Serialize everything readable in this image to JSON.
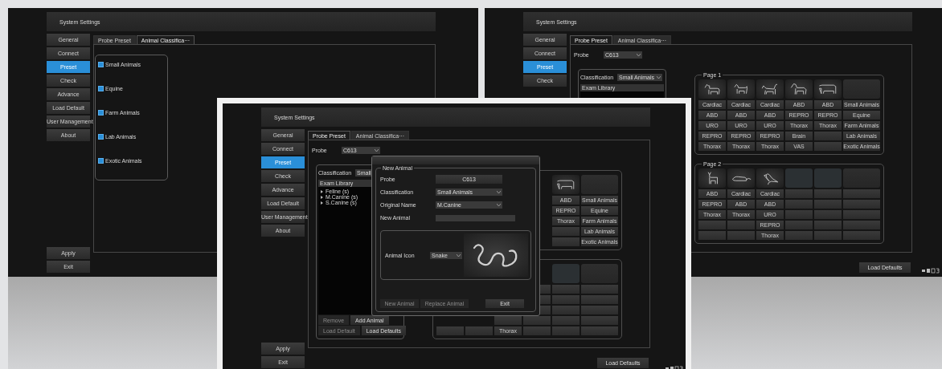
{
  "screens": [
    {
      "kind": "classification",
      "title": "System Settings",
      "sidebar": [
        {
          "label": "General",
          "selected": false
        },
        {
          "label": "Connect",
          "selected": false
        },
        {
          "label": "Preset",
          "selected": true
        },
        {
          "label": "Check",
          "selected": false
        },
        {
          "label": "Advance",
          "selected": false
        },
        {
          "label": "Load Default",
          "selected": false
        },
        {
          "label": "User Management",
          "selected": false
        },
        {
          "label": "About",
          "selected": false
        }
      ],
      "footer_buttons": [
        "Apply",
        "Exit"
      ],
      "tabs": [
        {
          "label": "Probe Preset",
          "selected": false
        },
        {
          "label": "Animal Classifica···",
          "selected": true
        }
      ],
      "animal_classes": [
        {
          "label": "Small Animals",
          "checked": true
        },
        {
          "label": "Equine",
          "checked": true
        },
        {
          "label": "Farm Animals",
          "checked": true
        },
        {
          "label": "Lab Animals",
          "checked": true
        },
        {
          "label": "Exotic Animals",
          "checked": true
        }
      ]
    },
    {
      "kind": "preset",
      "title": "System Settings",
      "sidebar": [
        {
          "label": "General",
          "selected": false
        },
        {
          "label": "Connect",
          "selected": false
        },
        {
          "label": "Preset",
          "selected": true
        },
        {
          "label": "Check",
          "selected": false
        }
      ],
      "tabs": [
        {
          "label": "Probe Preset",
          "selected": true
        },
        {
          "label": "Animal Classifica···",
          "selected": false
        }
      ],
      "probe": {
        "label": "Probe",
        "value": "C613"
      },
      "classification": {
        "label": "Classification",
        "value": "Small Animals",
        "library_header": "Exam Library"
      },
      "pages": [
        {
          "title": "Page 1",
          "columns": [
            {
              "kind": "animal",
              "cells": [
                "Cardiac",
                "ABD",
                "URO",
                "REPRO",
                "Thorax"
              ]
            },
            {
              "kind": "animal",
              "cells": [
                "Cardiac",
                "ABD",
                "URO",
                "REPRO",
                "Thorax"
              ]
            },
            {
              "kind": "animal",
              "cells": [
                "Cardiac",
                "ABD",
                "URO",
                "REPRO",
                "Thorax"
              ]
            },
            {
              "kind": "animal",
              "cells": [
                "ABD",
                "REPRO",
                "Thorax",
                "Brain",
                "VAS"
              ]
            },
            {
              "kind": "animal",
              "cells": [
                "ABD",
                "REPRO",
                "Thorax",
                null,
                null
              ]
            },
            {
              "kind": "blank",
              "cells": [
                "Small Animals",
                "Equine",
                "Farm Animals",
                "Lab Animals",
                "Exotic Animals"
              ]
            }
          ]
        },
        {
          "title": "Page 2",
          "columns": [
            {
              "kind": "animal",
              "cells": [
                "ABD",
                "REPRO",
                "Thorax",
                null,
                null
              ]
            },
            {
              "kind": "animal",
              "cells": [
                "Cardiac",
                "ABD",
                "Thorax",
                null,
                null
              ]
            },
            {
              "kind": "animal",
              "cells": [
                "Cardiac",
                "ABD",
                "URO",
                "REPRO",
                "Thorax"
              ]
            },
            {
              "kind": "empty",
              "cells": [
                null,
                null,
                null,
                null,
                null
              ]
            },
            {
              "kind": "empty",
              "cells": [
                null,
                null,
                null,
                null,
                null
              ]
            },
            {
              "kind": "blank",
              "cells": [
                null,
                null,
                null,
                null,
                null
              ]
            }
          ]
        }
      ],
      "load_defaults": "Load Defaults"
    },
    {
      "kind": "preset",
      "title": "System Settings",
      "sidebar": [
        {
          "label": "General",
          "selected": false
        },
        {
          "label": "Connect",
          "selected": false
        },
        {
          "label": "Preset",
          "selected": true
        },
        {
          "label": "Check",
          "selected": false
        },
        {
          "label": "Advance",
          "selected": false
        },
        {
          "label": "Load Default",
          "selected": false
        },
        {
          "label": "User Management",
          "selected": false
        },
        {
          "label": "About",
          "selected": false
        }
      ],
      "footer_buttons": [
        "Apply",
        "Exit"
      ],
      "tabs": [
        {
          "label": "Probe Preset",
          "selected": true
        },
        {
          "label": "Animal Classifica···",
          "selected": false
        }
      ],
      "probe": {
        "label": "Probe",
        "value": "C613"
      },
      "classification": {
        "label": "Classification",
        "value": "Small",
        "library_header": "Exam Library",
        "library": [
          "Feline (s)",
          "M.Canine (s)",
          "S.Canine (s)"
        ],
        "buttons": [
          [
            {
              "label": "Remove",
              "disabled": true
            },
            {
              "label": "Add Animal",
              "disabled": false
            }
          ],
          [
            {
              "label": "Load Default",
              "disabled": true
            },
            {
              "label": "Load Defaults",
              "disabled": false
            }
          ]
        ]
      },
      "pages": [
        {
          "columns": [
            {
              "kind": "animal",
              "cells": [
                "ABD",
                "REPRO",
                "Thorax",
                null,
                null
              ]
            },
            {
              "kind": "blank",
              "cells": [
                "Small Animals",
                "Equine",
                "Farm Animals",
                "Lab Animals",
                "Exotic Animals"
              ]
            }
          ]
        },
        {
          "columns": [
            {
              "cells": [
                null
              ]
            },
            {
              "cells": [
                null
              ]
            },
            {
              "cells": [
                null,
                null,
                null,
                null,
                "Thorax"
              ]
            },
            {
              "cells": [
                null,
                null,
                null,
                null,
                null
              ]
            },
            {
              "kind": "empty",
              "cells": [
                null,
                null,
                null,
                null,
                null
              ]
            },
            {
              "kind": "blank",
              "cells": [
                null,
                null,
                null,
                null,
                null
              ]
            }
          ]
        }
      ],
      "load_defaults": "Load Defaults",
      "dialog": {
        "group": "New Animal",
        "fields": [
          {
            "kind": "button",
            "label": "Probe",
            "value": "C613"
          },
          {
            "kind": "dropdown",
            "label": "Classification",
            "value": "Small Animals"
          },
          {
            "kind": "dropdown",
            "label": "Original Name",
            "value": "M.Canine"
          },
          {
            "kind": "input",
            "label": "New Animal"
          }
        ],
        "icon_label": "Animal Icon",
        "icon_value": "Snake",
        "buttons": [
          {
            "label": "New Animal",
            "disabled": true
          },
          {
            "label": "Replace Animal",
            "disabled": true
          },
          {
            "label": "Exit",
            "disabled": false
          }
        ]
      }
    }
  ]
}
